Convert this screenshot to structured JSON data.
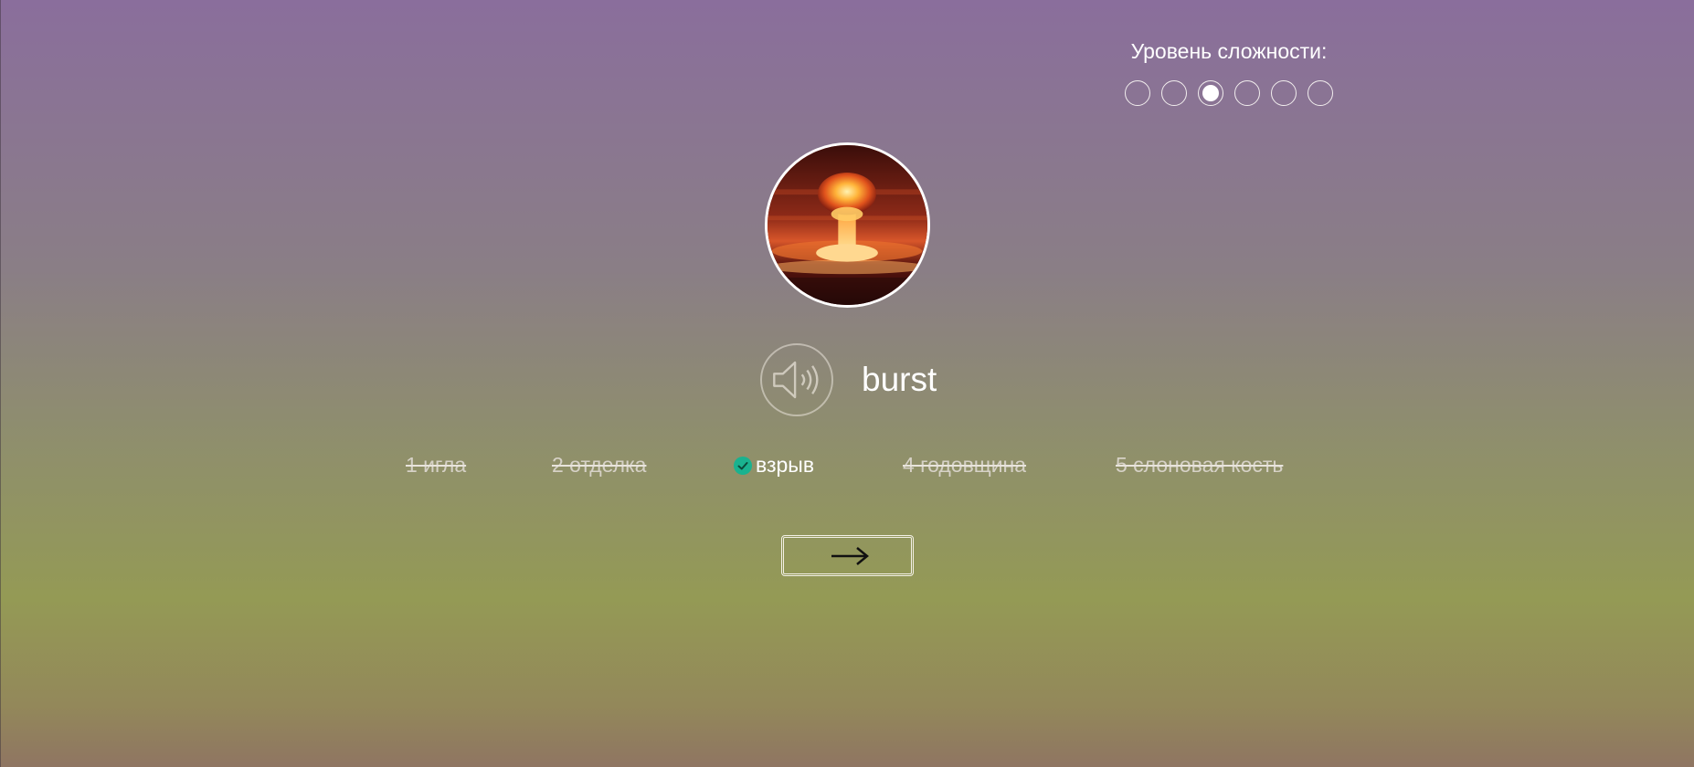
{
  "difficulty": {
    "title": "Уровень сложности:",
    "levels": 6,
    "selected": 3
  },
  "card": {
    "word": "burst",
    "picture_icon": "explosion-image",
    "audio_icon": "speaker-icon"
  },
  "answers": [
    {
      "label": "1 игла",
      "state": "wrong"
    },
    {
      "label": "2 отделка",
      "state": "wrong"
    },
    {
      "label": "взрыв",
      "state": "correct"
    },
    {
      "label": "4 годовщина",
      "state": "wrong"
    },
    {
      "label": "5 слоновая кость",
      "state": "wrong"
    }
  ],
  "next_button": {
    "icon": "arrow-right-icon"
  },
  "colors": {
    "correct_check": "#1ab28f",
    "text": "#ffffff",
    "wrong_text": "#d6d1c6"
  }
}
